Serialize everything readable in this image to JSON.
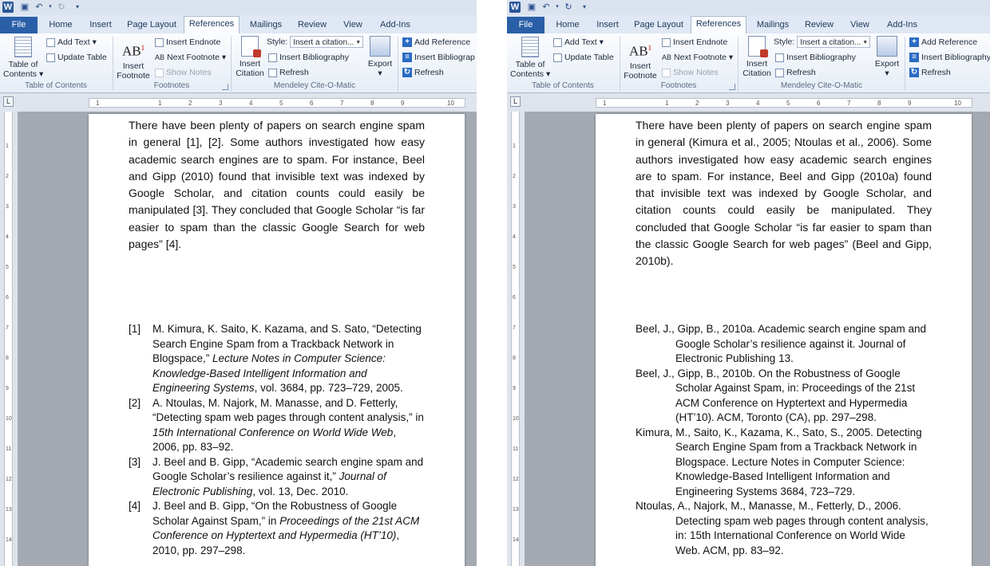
{
  "quick_access": {
    "word_icon": "W",
    "save_icon": "save-icon",
    "undo_icon": "undo-icon",
    "redo_icon": "redo-icon",
    "repeat_icon": "repeat-icon"
  },
  "tabs": [
    "File",
    "Home",
    "Insert",
    "Page Layout",
    "References",
    "Mailings",
    "Review",
    "View",
    "Add-Ins"
  ],
  "active_tab": "References",
  "ribbon": {
    "toc": {
      "label_line1": "Table of",
      "label_line2": "Contents",
      "add_text": "Add Text",
      "update_table": "Update Table",
      "group": "Table of Contents"
    },
    "footnotes": {
      "insert_footnote_line1": "Insert",
      "insert_footnote_line2": "Footnote",
      "ab_glyph": "AB",
      "insert_endnote": "Insert Endnote",
      "next_footnote": "Next Footnote",
      "show_notes": "Show Notes",
      "group": "Footnotes"
    },
    "mendeley": {
      "insert_citation_line1": "Insert",
      "insert_citation_line2": "Citation",
      "style_label": "Style:",
      "style_value": "Insert a citation...",
      "insert_bibliography": "Insert Bibliography",
      "refresh": "Refresh",
      "export": "Export",
      "group": "Mendeley Cite-O-Matic"
    },
    "extra": {
      "add_reference": "Add Reference",
      "insert_bibliography": "Insert Bibliograp",
      "insert_bibliography_right": "Insert Bibliography",
      "refresh": "Refresh"
    }
  },
  "ruler_marks": [
    "1",
    "1",
    "2",
    "3",
    "4",
    "5",
    "6",
    "7",
    "8",
    "9",
    "10"
  ],
  "vruler_marks": [
    "1",
    "2",
    "3",
    "4",
    "5",
    "6",
    "7",
    "8",
    "9",
    "10",
    "11",
    "12",
    "13",
    "14"
  ],
  "left_doc": {
    "paragraph": "There have been plenty of papers on search engine spam in general [1], [2]. Some authors investigated how easy academic search engines are to spam. For instance, Beel and Gipp (2010) found that invisible text was indexed by Google Scholar, and citation counts could easily be manipulated [3]. They concluded that Google Scholar “is far easier to spam than the classic Google Search for web pages” [4].",
    "refs": [
      {
        "num": "[1]",
        "a": "M. Kimura, K. Saito, K. Kazama, and S. Sato, “Detecting Search Engine Spam from a Trackback Network in Blogspace,” ",
        "i": "Lecture Notes in Computer Science: Knowledge-Based Intelligent Information and Engineering Systems",
        "b": ", vol. 3684, pp. 723–729, 2005."
      },
      {
        "num": "[2]",
        "a": "A. Ntoulas, M. Najork, M. Manasse, and D. Fetterly, “Detecting spam web pages through content analysis,” in ",
        "i": "15th International Conference on World Wide Web",
        "b": ", 2006, pp. 83–92."
      },
      {
        "num": "[3]",
        "a": "J. Beel and B. Gipp, “Academic search engine spam and Google Scholar’s resilience against it,” ",
        "i": "Journal of Electronic Publishing",
        "b": ", vol. 13, Dec. 2010."
      },
      {
        "num": "[4]",
        "a": "J. Beel and B. Gipp, “On the Robustness of Google Scholar Against Spam,” in ",
        "i": "Proceedings of the 21st ACM Conference on Hyptertext and Hypermedia (HT’10)",
        "b": ", 2010, pp. 297–298."
      }
    ]
  },
  "right_doc": {
    "paragraph": "There have been plenty of papers on search engine spam in general (Kimura et al., 2005; Ntoulas et al., 2006). Some authors investigated how easy academic search engines are to spam. For instance, Beel and Gipp (2010a) found that invisible text was indexed by Google Scholar, and citation counts could easily be manipulated. They concluded that Google Scholar “is far easier to spam than the classic Google Search for web pages” (Beel and Gipp, 2010b).",
    "refs": [
      "Beel, J., Gipp, B., 2010a. Academic search engine spam and Google Scholar’s resilience against it. Journal of Electronic Publishing 13.",
      "Beel, J., Gipp, B., 2010b. On the Robustness of Google Scholar Against Spam, in: Proceedings of the 21st ACM Conference on Hyptertext and Hypermedia (HT’10). ACM, Toronto (CA), pp. 297–298.",
      "Kimura, M., Saito, K., Kazama, K., Sato, S., 2005. Detecting Search Engine Spam from a Trackback Network in Blogspace. Lecture Notes in Computer Science: Knowledge-Based Intelligent Information and Engineering Systems 3684, 723–729.",
      "Ntoulas, A., Najork, M., Manasse, M., Fetterly, D., 2006. Detecting spam web pages through content analysis, in: 15th International Conference on World Wide Web. ACM, pp. 83–92."
    ]
  },
  "colors": {
    "file_tab": "#2a5fa8",
    "ribbon_bg": "#e6edf6",
    "workspace": "#a5aab2",
    "accent": "#2b579a"
  }
}
